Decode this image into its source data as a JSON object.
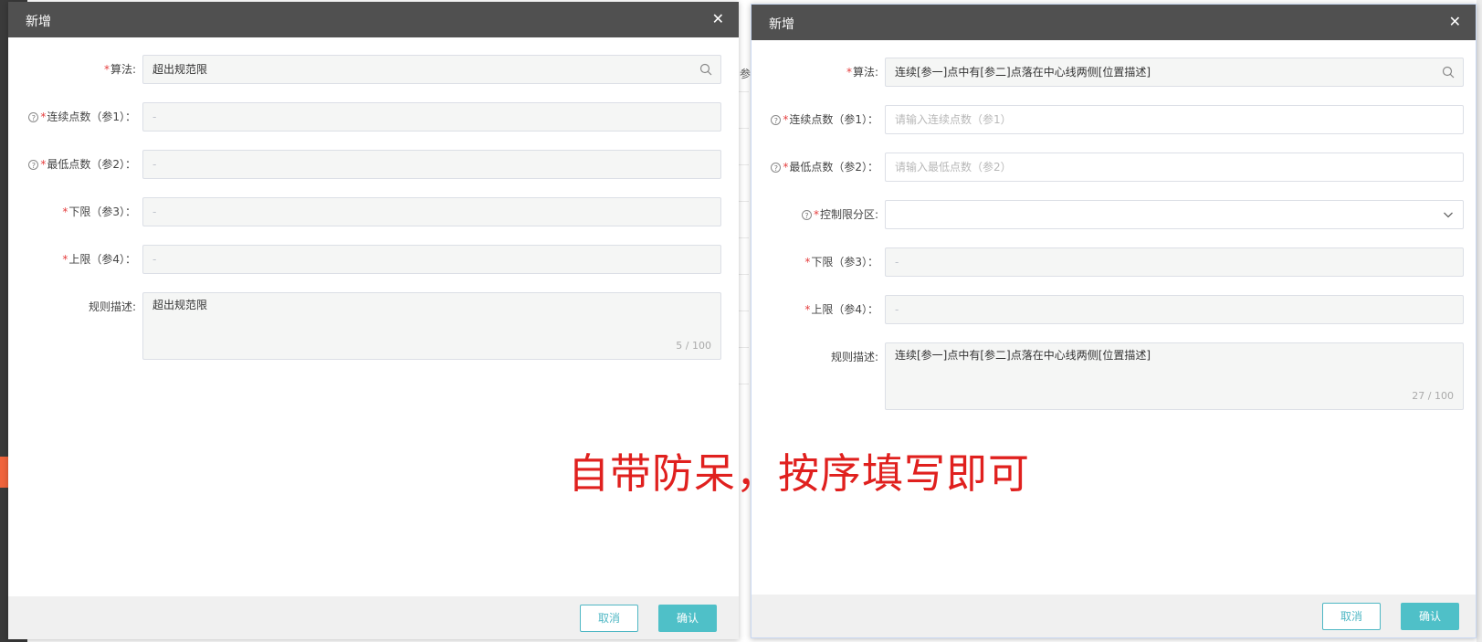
{
  "background": {
    "gap_text": "参"
  },
  "left_dialog": {
    "title": "新增",
    "close_glyph": "✕",
    "fields": {
      "algorithm": {
        "label": "算法:",
        "value": "超出规范限"
      },
      "consecutive_points": {
        "label": "连续点数（参1）：",
        "value": "-"
      },
      "min_points": {
        "label": "最低点数（参2）：",
        "value": "-"
      },
      "lower_limit": {
        "label": "下限（参3）：",
        "value": "-"
      },
      "upper_limit": {
        "label": "上限（参4）：",
        "value": "-"
      },
      "rule_description": {
        "label": "规则描述:",
        "value": "超出规范限",
        "counter": "5 / 100"
      }
    },
    "cancel_label": "取消",
    "confirm_label": "确认"
  },
  "right_dialog": {
    "title": "新增",
    "close_glyph": "✕",
    "fields": {
      "algorithm": {
        "label": "算法:",
        "value": "连续[参一]点中有[参二]点落在中心线两侧[位置描述]"
      },
      "consecutive_points": {
        "label": "连续点数（参1）：",
        "placeholder": "请输入连续点数（参1）"
      },
      "min_points": {
        "label": "最低点数（参2）：",
        "placeholder": "请输入最低点数（参2）"
      },
      "control_zone": {
        "label": "控制限分区:",
        "value": ""
      },
      "lower_limit": {
        "label": "下限（参3）：",
        "value": "-"
      },
      "upper_limit": {
        "label": "上限（参4）：",
        "value": "-"
      },
      "rule_description": {
        "label": "规则描述:",
        "value": "连续[参一]点中有[参二]点落在中心线两侧[位置描述]",
        "counter": "27 / 100"
      }
    },
    "cancel_label": "取消",
    "confirm_label": "确认"
  },
  "annotation_text": "自带防呆，按序填写即可",
  "icons": {
    "search": "search-icon",
    "close": "close-icon",
    "help": "help-circle-icon",
    "dropdown": "chevron-down-icon"
  },
  "colors": {
    "header_bg": "#505050",
    "required": "#e53e3e",
    "primary": "#4fc0c8",
    "annotation": "#e0201e"
  }
}
